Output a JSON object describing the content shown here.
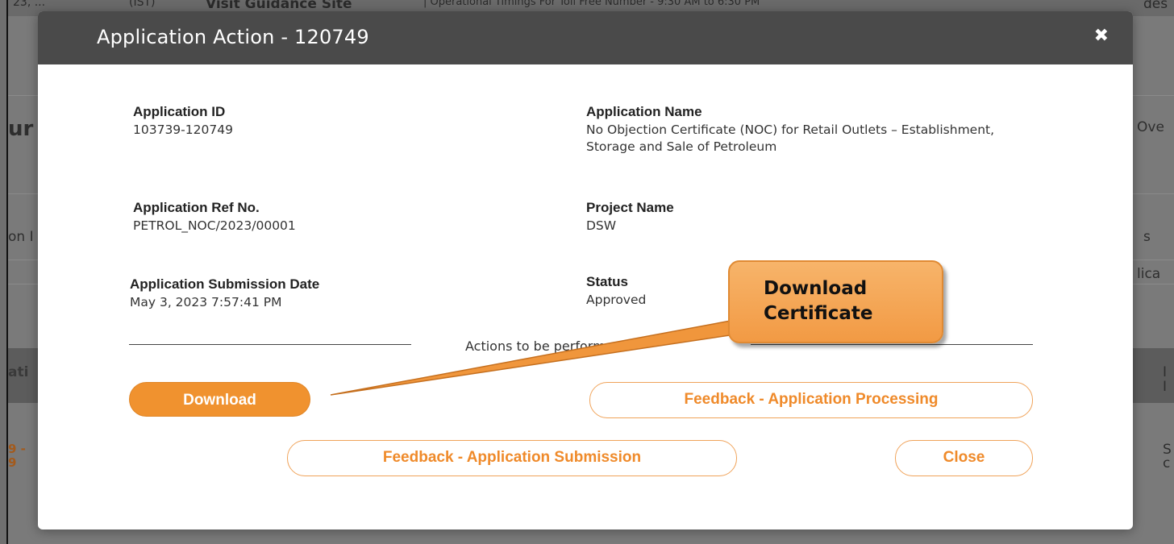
{
  "background": {
    "topbar": {
      "date_fragment": "23, ...",
      "tz_fragment": "(IST)",
      "guidance": "Visit Guidance Site",
      "timings": "| Operational Timings For Toll Free Number - 9:30 AM to 6:30 PM",
      "right_fragment": "des"
    },
    "left_fragments": [
      "ur",
      "on I",
      "ati",
      "9 -",
      "9"
    ],
    "right_fragments": [
      "Ove",
      "s",
      "lica",
      "I",
      "I",
      "S",
      "c"
    ]
  },
  "modal": {
    "title": "Application Action - 120749",
    "close_icon": "close-icon",
    "fields": {
      "application_id": {
        "label": "Application ID",
        "value": "103739-120749"
      },
      "application_name": {
        "label": "Application Name",
        "value": "No Objection Certificate (NOC) for Retail Outlets – Establishment, Storage and Sale of Petroleum"
      },
      "ref_no": {
        "label": "Application Ref No.",
        "value": "PETROL_NOC/2023/00001"
      },
      "project_name": {
        "label": "Project Name",
        "value": "DSW"
      },
      "submission_date": {
        "label": "Application Submission Date",
        "value": "May 3, 2023 7:57:41 PM"
      },
      "status": {
        "label": "Status",
        "value": "Approved"
      }
    },
    "actions_label": "Actions to be performed",
    "buttons": {
      "download": "Download",
      "feedback_processing": "Feedback - Application Processing",
      "feedback_submission": "Feedback - Application Submission",
      "close": "Close"
    }
  },
  "callout": {
    "line1": "Download",
    "line2": "Certificate",
    "color": "#f29a44"
  }
}
